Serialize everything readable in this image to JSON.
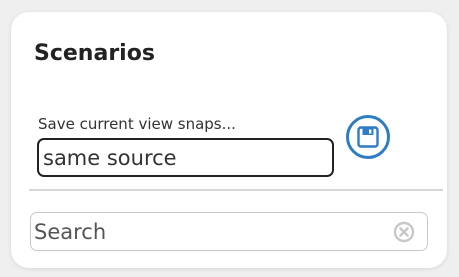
{
  "panel": {
    "title": "Scenarios"
  },
  "snapshot": {
    "label": "Save current view snaps...",
    "value": "same source",
    "save_icon": "floppy-disk-icon",
    "accent_color": "#2e7cc4"
  },
  "search": {
    "placeholder": "Search",
    "value": "",
    "clear_icon": "clear-circle-icon"
  }
}
